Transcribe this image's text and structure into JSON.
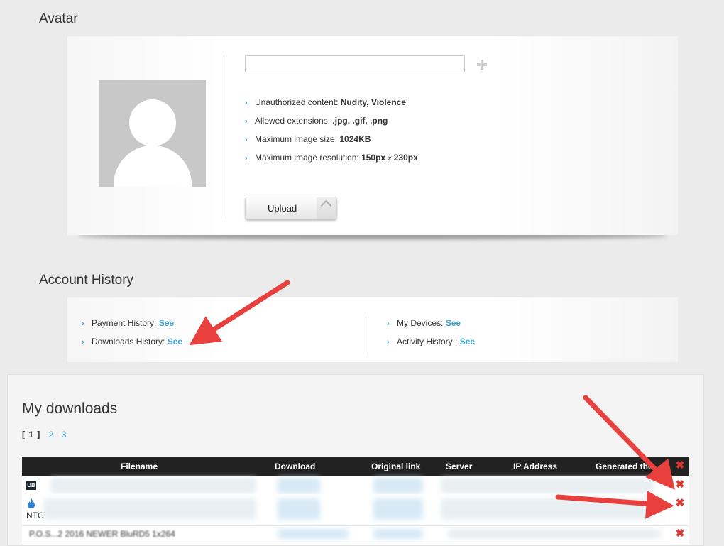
{
  "avatar_section": {
    "title": "Avatar",
    "file_input_value": "",
    "rules": [
      {
        "label": "Unauthorized content:",
        "value": "Nudity, Violence"
      },
      {
        "label": "Allowed extensions:",
        "value": ".jpg, .gif, .png"
      },
      {
        "label": "Maximum image size:",
        "value": "1024KB"
      },
      {
        "label": "Maximum image resolution:",
        "value_a": "150px",
        "sep": "x",
        "value_b": "230px"
      }
    ],
    "upload_label": "Upload"
  },
  "account_history": {
    "title": "Account History",
    "items": [
      {
        "label": "Payment History:",
        "link": "See"
      },
      {
        "label": "Downloads History:",
        "link": "See"
      },
      {
        "label": "My Devices:",
        "link": "See"
      },
      {
        "label": "Activity History :",
        "link": "See"
      }
    ]
  },
  "downloads": {
    "title": "My downloads",
    "current_page": "[ 1 ]",
    "pages": [
      "2",
      "3"
    ],
    "columns": [
      "Filename",
      "Download",
      "Original link",
      "Server",
      "IP Address",
      "Generated the"
    ],
    "rows": [
      {
        "site_icon": "site-logo-icon",
        "partial_text": ""
      },
      {
        "site_icon": "flame-icon",
        "partial_text": "NTC"
      },
      {
        "site_icon": "file-icon",
        "partial_text": "P.O.S...2 2016 NEWER BluRD5 1x264"
      }
    ]
  },
  "colors": {
    "accent": "#3aa5d6",
    "delete": "#e0352b",
    "annotation_arrow": "#e8403c",
    "table_header": "#222222"
  }
}
